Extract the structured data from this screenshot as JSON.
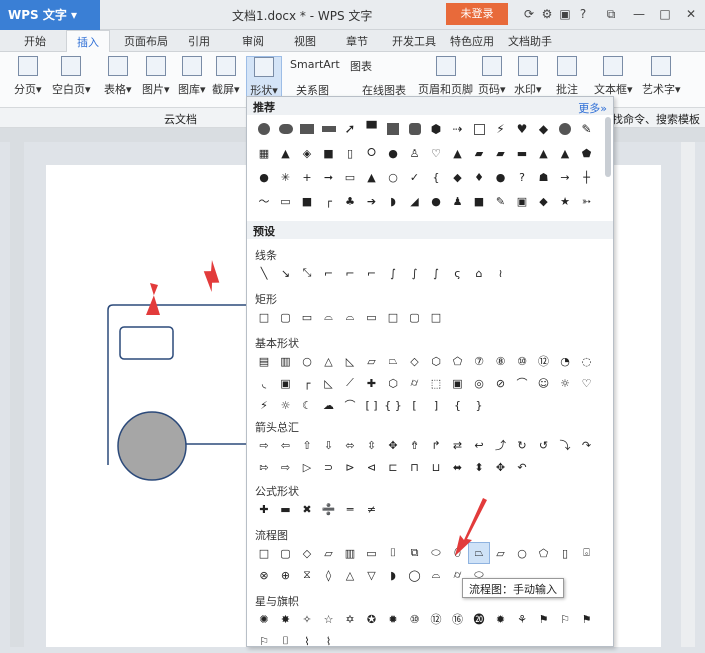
{
  "app": {
    "name": "WPS 文字",
    "title": "文档1.docx * - WPS 文字",
    "login": "未登录"
  },
  "tabs": [
    "开始",
    "插入",
    "页面布局",
    "引用",
    "审阅",
    "视图",
    "章节",
    "开发工具",
    "特色应用",
    "文档助手"
  ],
  "ribbon": {
    "buttons": [
      "分页",
      "空白页",
      "表格",
      "图片",
      "图库",
      "截屏",
      "形状",
      "SmartArt",
      "图表",
      "关系图",
      "在线图表",
      "页眉和页脚",
      "页码",
      "水印",
      "批注",
      "文本框",
      "艺术字"
    ]
  },
  "quickbar": {
    "cloud": "云文档",
    "right_text": "找命令、搜索模板"
  },
  "panel": {
    "recommend": "推荐",
    "more": "更多»",
    "preset": "预设",
    "sections": [
      "线条",
      "矩形",
      "基本形状",
      "箭头总汇",
      "公式形状",
      "流程图",
      "星与旗帜"
    ]
  },
  "tooltip": "流程图：手动输入",
  "colors": {
    "accent": "#3a7fd5",
    "login": "#e86a3a",
    "shape_fill": "#a6a6a6",
    "arrow": "#e23b3b"
  }
}
